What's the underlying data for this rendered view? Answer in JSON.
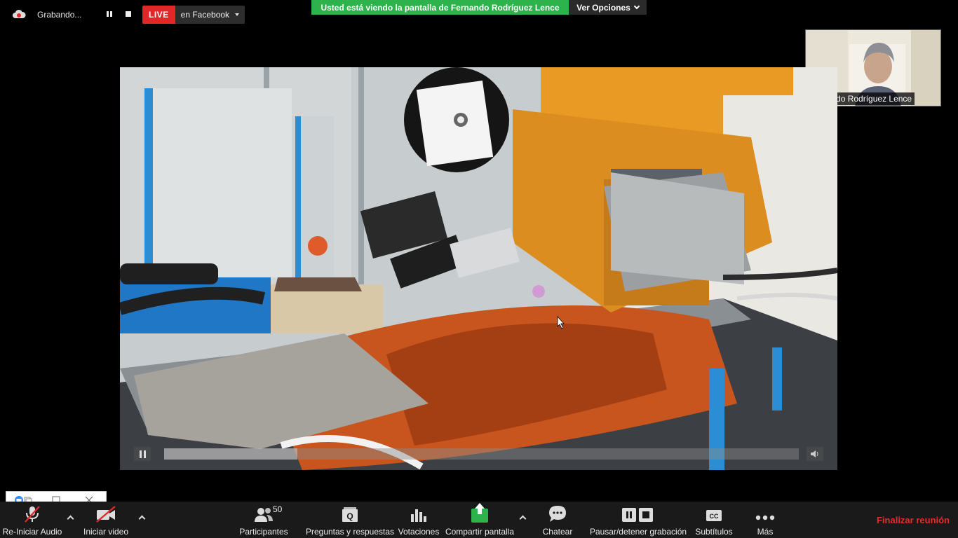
{
  "top_bar": {
    "recording_label": "Grabando...",
    "live_badge": "LIVE",
    "live_destination": "en Facebook"
  },
  "banner": {
    "viewing_text": "Usted está viendo la pantalla de Fernando Rodríguez Lence",
    "view_options": "Ver Opciones"
  },
  "participant_thumbnail": {
    "name": "Fernando Rodríguez Lence"
  },
  "shared_video": {
    "progress": 0.21
  },
  "toolbar": {
    "audio": "Re-Iniciar Audio",
    "video": "Iniciar video",
    "participants": "Participantes",
    "participants_count": "50",
    "qa": "Preguntas y respuestas",
    "polls": "Votaciones",
    "share": "Compartir pantalla",
    "chat": "Chatear",
    "recording": "Pausar/detener grabación",
    "captions": "Subtítulos",
    "captions_icon": "CC",
    "more": "Más",
    "end": "Finalizar reunión"
  },
  "icons": {
    "mic": "mic-muted-icon",
    "camera": "camera-off-icon",
    "participants": "people-icon",
    "qa": "qa-icon",
    "polls": "bar-chart-icon",
    "share": "share-arrow-icon",
    "chat": "chat-bubble-icon",
    "recording": "pause-stop-icon",
    "more": "ellipsis-icon"
  },
  "colors": {
    "live": "#e02828",
    "banner": "#2eb24b",
    "share": "#2eb24b",
    "end": "#e0302d"
  }
}
